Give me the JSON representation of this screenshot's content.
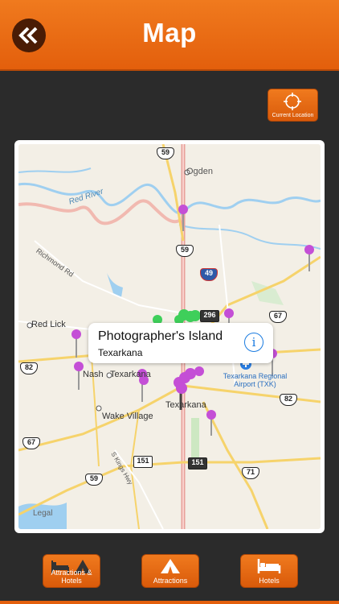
{
  "header": {
    "title": "Map",
    "back_icon": "double-chevron-left-icon"
  },
  "current_location": {
    "label": "Current Location",
    "icon": "crosshair-icon"
  },
  "map": {
    "labels": {
      "ogden": "Ogden",
      "red_river": "Red River",
      "richmond_rd": "Richmond Rd",
      "red_lick": "Red Lick",
      "nash": "Nash",
      "texarkana_west": "Texarkana",
      "texarkana_center": "Texarkana",
      "airport": "Texarkana Regional Airport (TXK)",
      "wake_village": "Wake Village",
      "kings_hwy": "S Kings Hwy",
      "legal": "Legal"
    },
    "shields": {
      "r59_top": "59",
      "r59_mid": "59",
      "i49": "49",
      "r296": "296",
      "r67_right": "67",
      "r82_left": "82",
      "r82_right": "82",
      "r67_left": "67",
      "r59_bottom": "59",
      "r151_a": "151",
      "r151_b": "151",
      "r71": "71"
    },
    "callout": {
      "title": "Photographer's Island",
      "subtitle": "Texarkana",
      "info_icon": "info-icon"
    }
  },
  "bottom_bar": {
    "attractions_hotels": "Attractions & Hotels",
    "attractions": "Attractions",
    "hotels": "Hotels"
  },
  "colors": {
    "accent": "#e86a14",
    "dark": "#2b2b2b",
    "pin": "#c44fd6",
    "green_pin": "#3ecf5a"
  }
}
